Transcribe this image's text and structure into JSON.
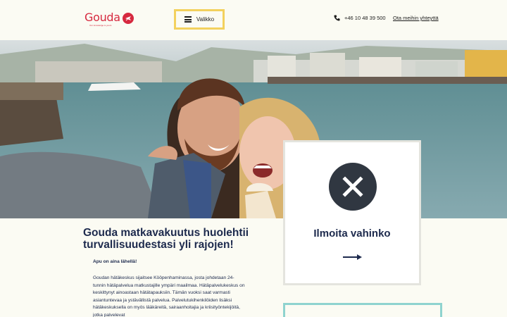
{
  "header": {
    "logo_text": "Gouda",
    "logo_tagline": "Our knowledge is yours",
    "menu_label": "Valikko",
    "phone_number": "+46 10 48 39 500",
    "contact_link": "Ota meihin yhteyttä"
  },
  "hero": {
    "image": "selfie-couple-harbour-photo"
  },
  "main": {
    "headline": "Gouda matkavakuutus huolehtii turvallisuudestasi yli rajojen!",
    "subheading": "Apu on aina lähellä!",
    "body": "Goudan hätäkeskus sijaitsee Kööpenhaminassa, josta johdetaan 24-tunnin hätäpalvelua matkustajille ympäri maailmaa. Hätäpalvelukeskus on keskittynyt ainoastaan hätätapauksiin. Tämän vuoksi saat varmasti asiantuntevaa ja ystävällistä palvelua. Palvelutukihenkilöiden lisäksi hätäkeskuksella on myös lääkäreitä, sairaanhoitajia ja kriisityöntekijöitä, jotka palvelevat"
  },
  "claim_card": {
    "title": "Ilmoita vahinko",
    "icon": "close-x-icon",
    "arrow_icon": "arrow-right-icon"
  },
  "colors": {
    "brand_red": "#d6293f",
    "navy": "#1d2a4d",
    "menu_border": "#f3d15e",
    "icon_circle": "#303741",
    "teal_border": "#8fd3cf",
    "page_bg": "#fbfbf3"
  }
}
